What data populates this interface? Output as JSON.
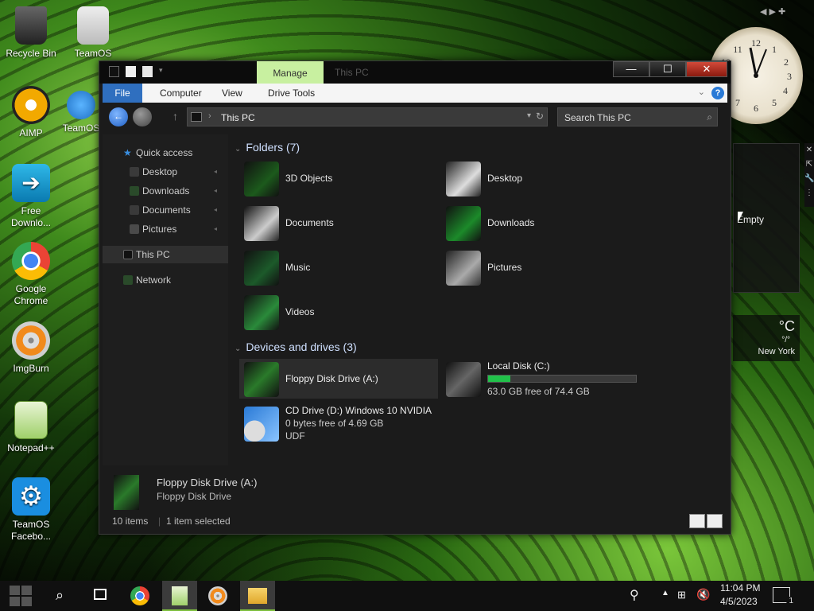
{
  "desktop": {
    "icons": [
      {
        "label": "Recycle Bin"
      },
      {
        "label": "TeamOS"
      },
      {
        "label": "AIMP"
      },
      {
        "label": "TeamOS"
      },
      {
        "label": "Free Downlo..."
      },
      {
        "label": "Google Chrome"
      },
      {
        "label": "ImgBurn"
      },
      {
        "label": "Notepad++"
      },
      {
        "label": "TeamOS Facebo..."
      }
    ]
  },
  "window": {
    "ribbon_contextual_tab": "Manage",
    "title": "This PC",
    "controls": {
      "minimize": "—",
      "maximize": "☐",
      "close": "✕"
    },
    "ribbon_tabs": [
      "File",
      "Computer",
      "View",
      "Drive Tools"
    ],
    "help": "?",
    "address": "This PC",
    "search_placeholder": "Search This PC"
  },
  "sidebar": {
    "quick_access": "Quick access",
    "quick_items": [
      "Desktop",
      "Downloads",
      "Documents",
      "Pictures"
    ],
    "this_pc": "This PC",
    "network": "Network"
  },
  "content": {
    "folders_header": "Folders (7)",
    "folders": [
      "3D Objects",
      "Desktop",
      "Documents",
      "Downloads",
      "Music",
      "Pictures",
      "Videos"
    ],
    "devices_header": "Devices and drives (3)",
    "floppy": {
      "name": "Floppy Disk Drive (A:)"
    },
    "local_disk": {
      "name": "Local Disk (C:)",
      "free_text": "63.0 GB free of 74.4 GB",
      "used_fraction": 0.153
    },
    "cd_drive": {
      "name": "CD Drive (D:) Windows 10 NVIDIA",
      "free_text": "0 bytes free of 4.69 GB",
      "fs": "UDF"
    }
  },
  "details": {
    "title": "Floppy Disk Drive (A:)",
    "subtitle": "Floppy Disk Drive"
  },
  "status": {
    "items": "10 items",
    "selected": "1 item selected"
  },
  "gadget": {
    "text": "Empty"
  },
  "weather": {
    "unit": "°C",
    "sub": "°/°",
    "city": "New York"
  },
  "taskbar": {
    "time": "11:04 PM",
    "date": "4/5/2023",
    "notifications": "1"
  }
}
